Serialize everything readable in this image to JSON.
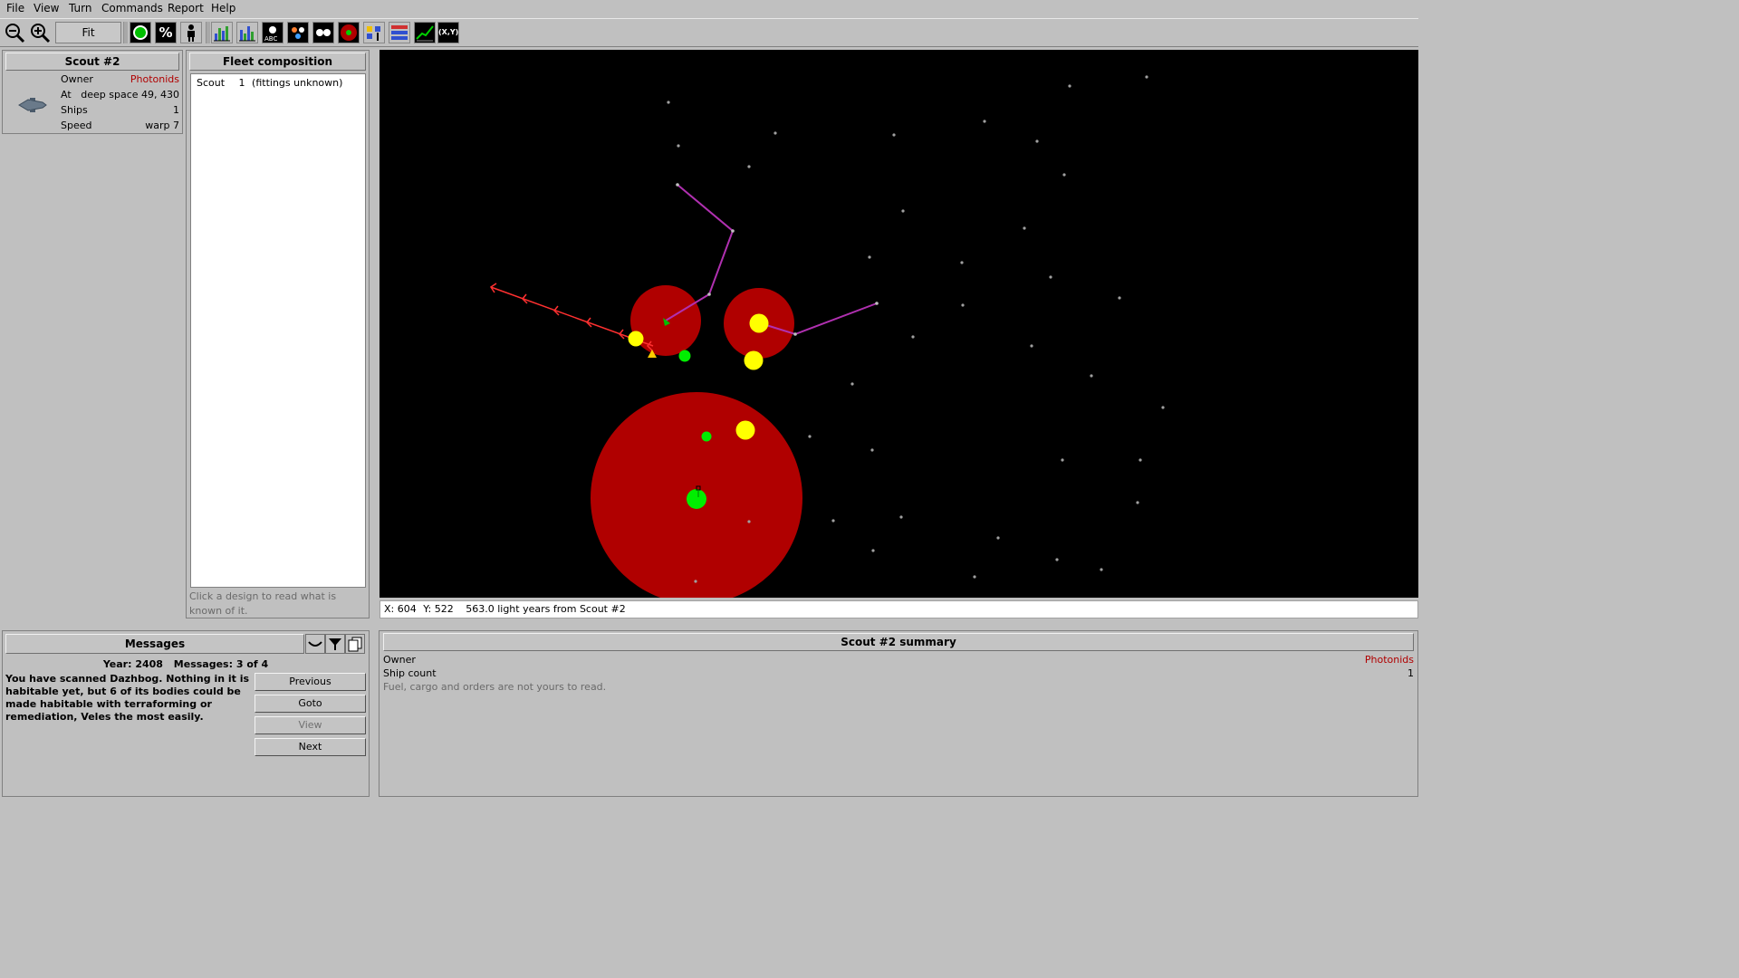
{
  "menu": [
    "File",
    "View",
    "Turn",
    "Commands",
    "Report",
    "Help"
  ],
  "toolbar": {
    "fit_label": "Fit",
    "percent_glyph": "%",
    "xy_label": "(X,Y)",
    "abc_label": "ABC"
  },
  "fleet": {
    "title": "Scout #2",
    "owner_label": "Owner",
    "owner_value": "Photonids",
    "at_label": "At",
    "at_value": "deep space 49, 430",
    "ships_label": "Ships",
    "ships_value": "1",
    "speed_label": "Speed",
    "speed_value": "warp 7"
  },
  "composition": {
    "title": "Fleet composition",
    "items": [
      {
        "name": "Scout",
        "count": "1",
        "note": "(fittings unknown)"
      }
    ],
    "hint": "Click a design to read what is known of it."
  },
  "messages": {
    "title": "Messages",
    "year_label": "Year:",
    "year": "2408",
    "count_label": "Messages:",
    "count": "3 of 4",
    "text": "You have scanned Dazhbog. Nothing in it is habitable yet, but 6 of its bodies could be made habitable with terraforming or remediation, Veles the most easily.",
    "buttons": {
      "previous": "Previous",
      "goto": "Goto",
      "view": "View",
      "next": "Next"
    }
  },
  "statusbar": {
    "x_label": "X:",
    "x": "604",
    "y_label": "Y:",
    "y": "522",
    "distance": "563.0 light years from Scout #2"
  },
  "summary": {
    "title": "Scout #2 summary",
    "owner_label": "Owner",
    "owner_value": "Photonids",
    "ship_count_label": "Ship count",
    "ship_count_value": "1",
    "note": "Fuel, cargo and orders are not yours to read."
  },
  "colors": {
    "owner": "#b00000",
    "territory": "#b00000",
    "star_yellow": "#ffff00",
    "star_green": "#00ee00",
    "route_magenta": "#b030b0",
    "route_red": "#ff3030"
  }
}
